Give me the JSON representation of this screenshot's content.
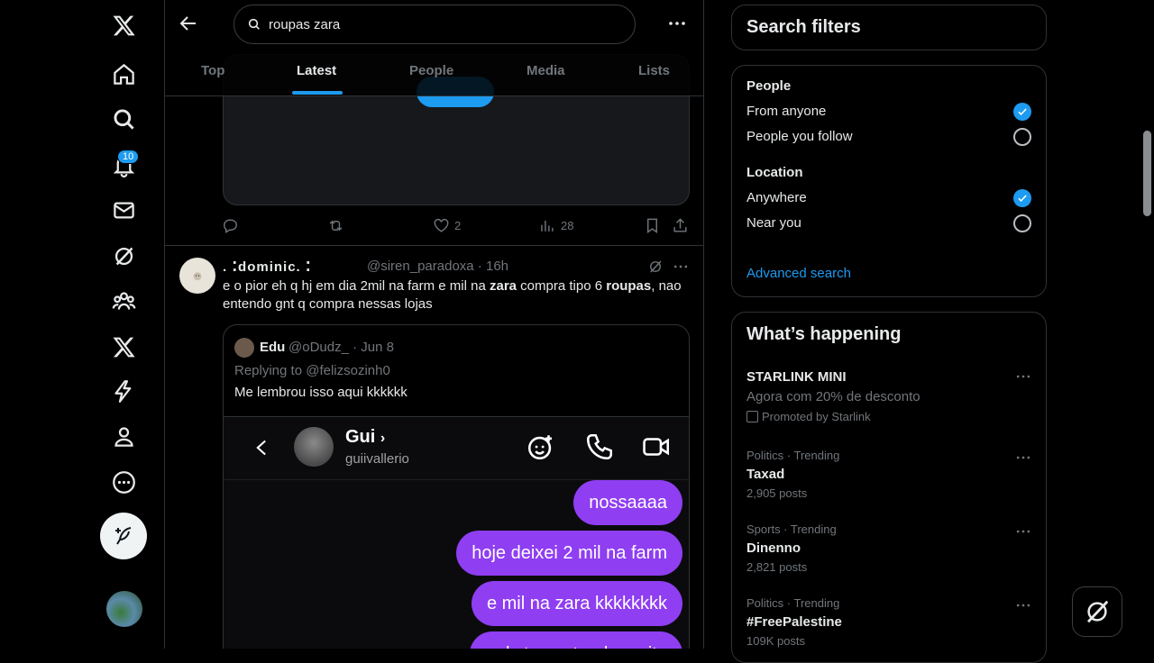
{
  "nav": {
    "notifications_badge": "10"
  },
  "search": {
    "query": "roupas zara"
  },
  "tabs": [
    "Top",
    "Latest",
    "People",
    "Media",
    "Lists"
  ],
  "prev_tweet": {
    "likes": "2",
    "views": "28"
  },
  "tweet": {
    "display_name": ". ⁚dominic. ⁚",
    "handle": "@siren_paradoxa",
    "time": "16h",
    "text_1": "e o pior eh q hj em dia 2mil na farm e mil na ",
    "bold_1": "zara",
    "text_2": " compra tipo 6 ",
    "bold_2": "roupas",
    "text_3": ", nao entendo gnt q compra nessas lojas"
  },
  "quote": {
    "name": "Edu",
    "handle": "@oDudz_ · Jun 8",
    "replying": "Replying to @felizsozinh0",
    "text": "Me lembrou isso aqui kkkkkk"
  },
  "dm": {
    "name": "Gui",
    "username": "guiivallerio",
    "messages": [
      "nossaaaa",
      "hoje deixei 2 mil na farm",
      "e mil na zara kkkkkkkk",
      "mds to gastando muito"
    ]
  },
  "filters": {
    "title": "Search filters",
    "people_label": "People",
    "from_anyone": "From anyone",
    "people_you_follow": "People you follow",
    "location_label": "Location",
    "anywhere": "Anywhere",
    "near_you": "Near you",
    "advanced": "Advanced search"
  },
  "happening": {
    "title": "What’s happening",
    "promo_name": "STARLINK MINI",
    "promo_text": "Agora com 20% de desconto",
    "promo_by": "Promoted by Starlink",
    "trends": [
      {
        "meta": "Politics · Trending",
        "name": "Taxad",
        "posts": "2,905 posts"
      },
      {
        "meta": "Sports · Trending",
        "name": "Dinenno",
        "posts": "2,821 posts"
      },
      {
        "meta": "Politics · Trending",
        "name": "#FreePalestine",
        "posts": "109K posts"
      }
    ]
  },
  "colors": {
    "accent": "#1d9bf0",
    "dm_bubble": "#8f3ef2",
    "background": "#000000",
    "border": "#2f3336"
  }
}
